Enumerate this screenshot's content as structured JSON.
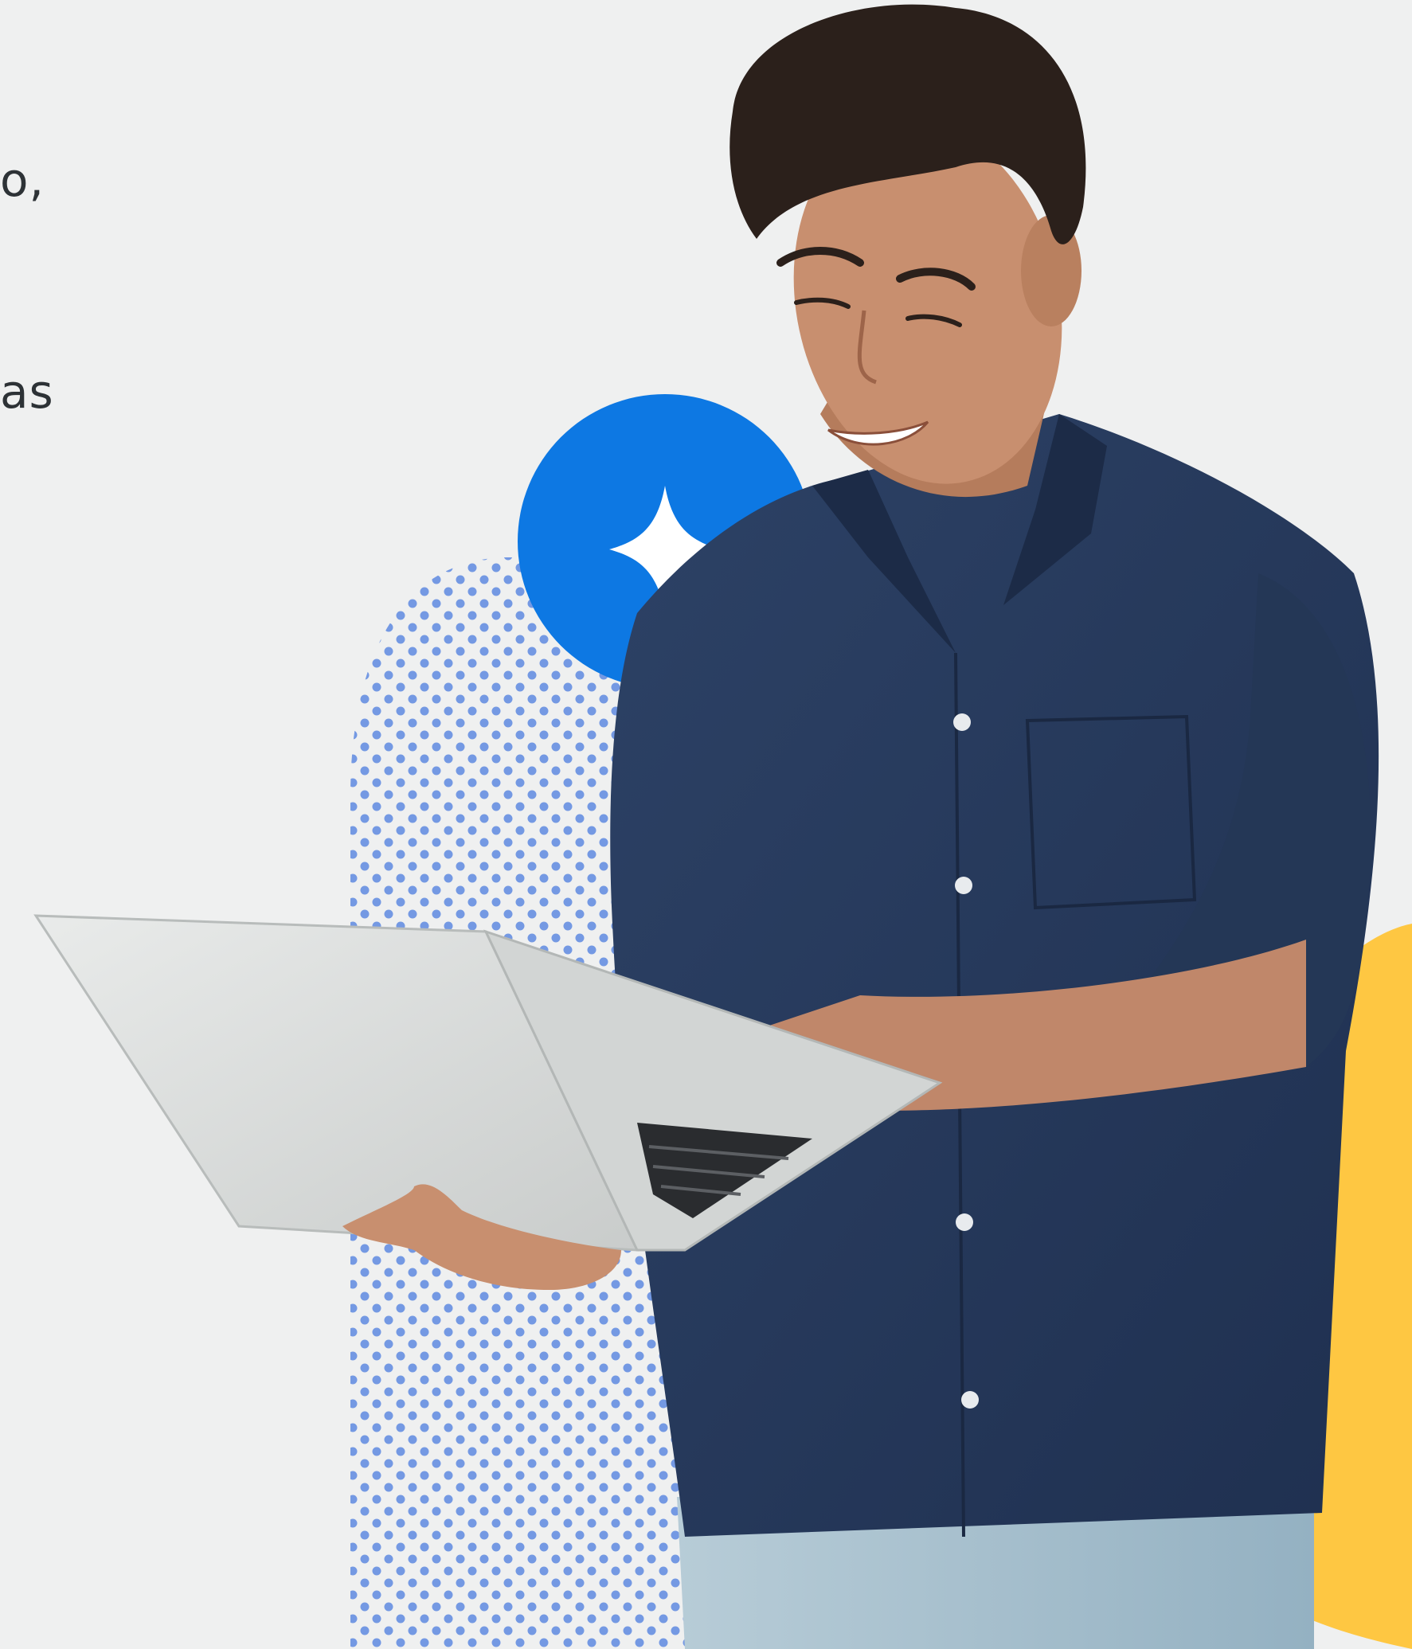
{
  "text_fragments": {
    "line1": "o,",
    "line2": "as"
  },
  "colors": {
    "background": "#eff0f0",
    "badge_blue": "#0d78e3",
    "dots_blue": "#7499e3",
    "accent_yellow": "#fec742",
    "shirt_navy": "#263a5c",
    "laptop_silver": "#d8dbdb",
    "skin": "#c88f6f",
    "hair": "#2b201b",
    "jeans": "#a9c2cf"
  },
  "icons": {
    "badge": "sparkle-icon"
  }
}
